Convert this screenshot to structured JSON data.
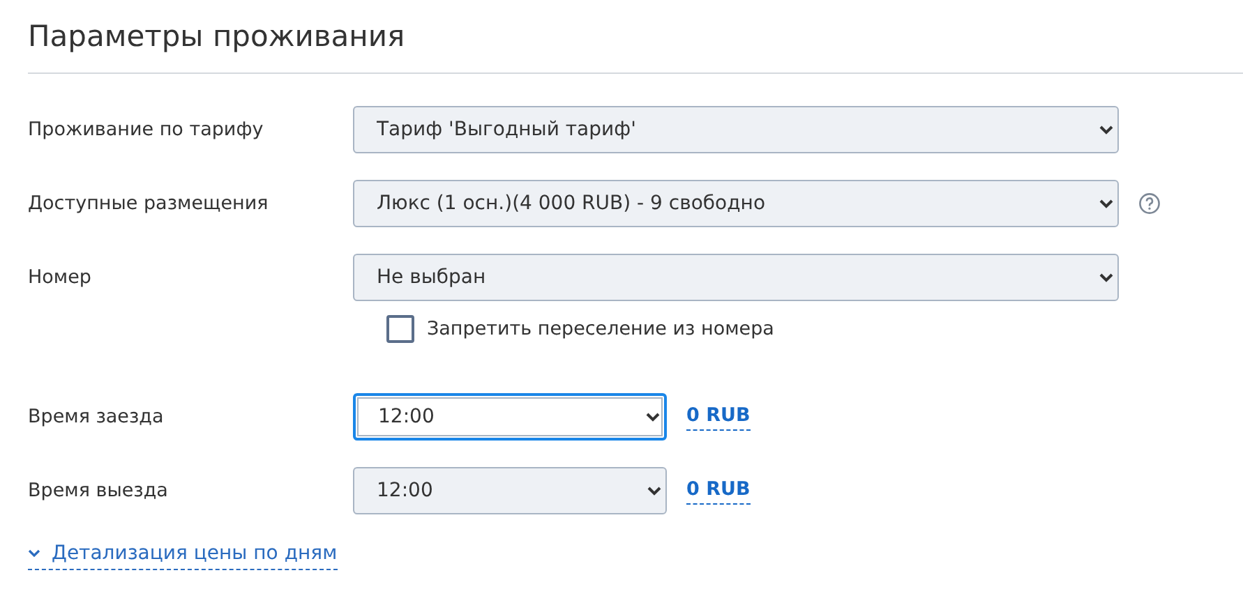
{
  "title": "Параметры проживания",
  "fields": [
    {
      "label": "Проживание по тарифу",
      "value": "Тариф 'Выгодный тариф'",
      "focused": false,
      "help": false
    },
    {
      "label": "Доступные размещения",
      "value": "Люкс (1 осн.)(4 000 RUB) - 9 свободно",
      "focused": false,
      "help": true
    },
    {
      "label": "Номер",
      "value": "Не выбран",
      "focused": false,
      "help": false
    }
  ],
  "checkbox": {
    "label": "Запретить переселение из номера",
    "checked": false
  },
  "times": [
    {
      "label": "Время заезда",
      "value": "12:00",
      "focused": true,
      "price": "0 RUB"
    },
    {
      "label": "Время выезда",
      "value": "12:00",
      "focused": false,
      "price": "0 RUB"
    }
  ],
  "details_link": {
    "label": "Детализация цены по дням",
    "expanded": false
  }
}
